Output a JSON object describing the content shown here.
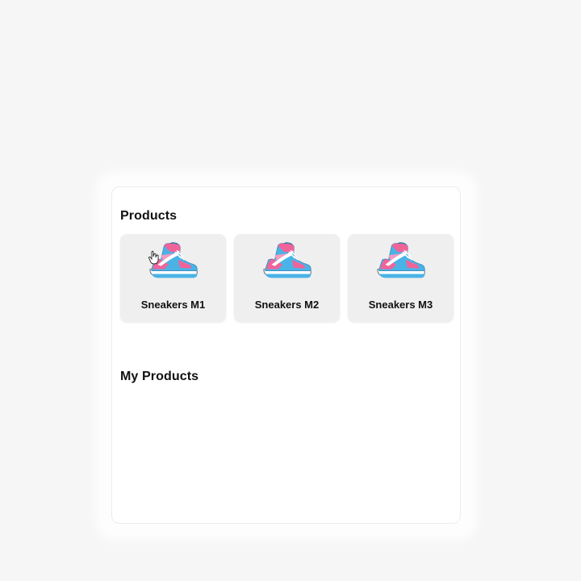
{
  "sections": {
    "products_title": "Products",
    "my_products_title": "My Products"
  },
  "products": [
    {
      "name": "Sneakers M1",
      "icon": "sneaker-icon"
    },
    {
      "name": "Sneakers M2",
      "icon": "sneaker-icon"
    },
    {
      "name": "Sneakers M3",
      "icon": "sneaker-icon"
    }
  ],
  "my_products": [],
  "colors": {
    "page_background": "#f6f6f6",
    "card_background": "#efefef",
    "sneaker_blue": "#4ab3e6",
    "sneaker_pink": "#f0649a"
  },
  "cursor": {
    "icon": "hand-pointer-icon"
  }
}
